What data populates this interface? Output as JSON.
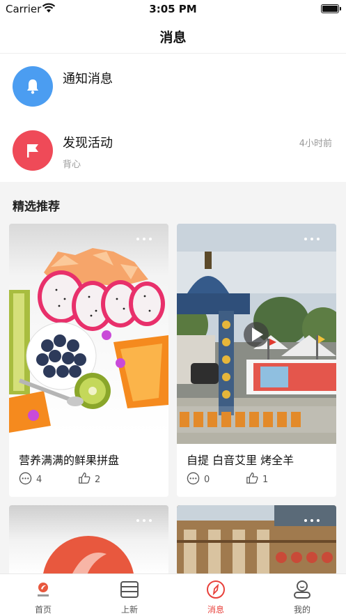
{
  "status": {
    "carrier": "Carrier",
    "time": "3:05 PM"
  },
  "header": {
    "title": "消息"
  },
  "messages": [
    {
      "title": "通知消息",
      "subtitle": "",
      "time": "",
      "icon": "bell-icon",
      "color": "#4b9df1"
    },
    {
      "title": "发现活动",
      "subtitle": "背心",
      "time": "4小时前",
      "icon": "flag-icon",
      "color": "#ef4a58"
    }
  ],
  "section": {
    "title": "精选推荐"
  },
  "cards": [
    {
      "title": "营养满满的鲜果拼盘",
      "comments": "4",
      "likes": "2",
      "image": "fruit-platter-photo",
      "video": false
    },
    {
      "title": "自提 白音艾里 烤全羊",
      "comments": "0",
      "likes": "1",
      "image": "mongolian-gate-photo",
      "video": true
    },
    {
      "title": "",
      "image": "app-logo-photo"
    },
    {
      "title": "",
      "image": "building-photo"
    }
  ],
  "tabs": [
    {
      "label": "首页",
      "icon": "home-logo-icon",
      "active": false
    },
    {
      "label": "上新",
      "icon": "new-icon",
      "active": false
    },
    {
      "label": "消息",
      "icon": "compass-icon",
      "active": true
    },
    {
      "label": "我的",
      "icon": "profile-icon",
      "active": false
    }
  ],
  "colors": {
    "accent": "#e8413b",
    "bell": "#4b9df1",
    "flag": "#ef4a58"
  }
}
